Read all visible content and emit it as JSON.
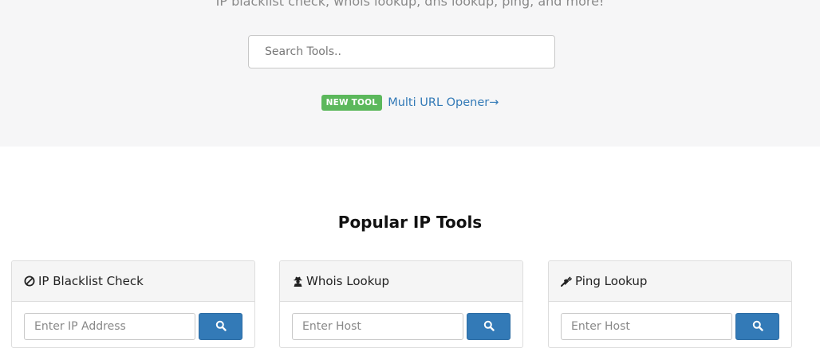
{
  "hero": {
    "tagline": "IP blacklist check, whois lookup, dns lookup, ping, and more!",
    "search_placeholder": "Search Tools..",
    "new_tool": {
      "badge": "NEW TOOL",
      "link_text": "Multi URL Opener→"
    }
  },
  "popular": {
    "title": "Popular IP Tools",
    "cards": [
      {
        "title": "IP Blacklist Check",
        "icon": "ban-icon",
        "placeholder": "Enter IP Address",
        "button_icon": "search-icon"
      },
      {
        "title": "Whois Lookup",
        "icon": "user-secret-icon",
        "placeholder": "Enter Host",
        "button_icon": "search-icon"
      },
      {
        "title": "Ping Lookup",
        "icon": "plug-icon",
        "placeholder": "Enter Host",
        "button_icon": "search-icon"
      }
    ]
  },
  "colors": {
    "hero_bg": "#f6f6f7",
    "badge_green": "#5cb85c",
    "link_blue": "#337ab7",
    "button_blue": "#337ab7"
  }
}
